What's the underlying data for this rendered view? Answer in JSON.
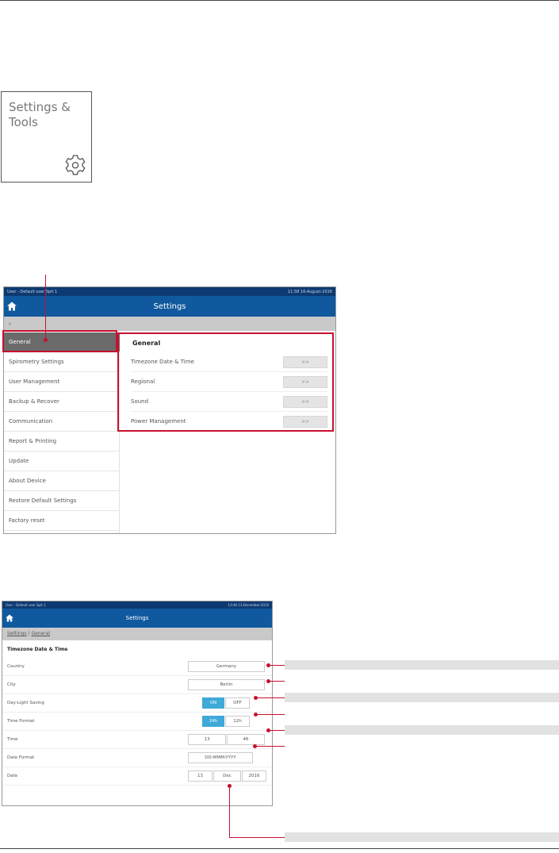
{
  "tile": {
    "title": "Settings &\nTools",
    "icon": "gear-icon"
  },
  "screen1": {
    "status_left": "User - Default user Spit 1",
    "status_right": "11:58 16-August-2016",
    "title": "Settings",
    "crumb": ">",
    "sidebar": [
      "General",
      "Spirometry Settings",
      "User Management",
      "Backup & Recover",
      "Communication",
      "Report & Printing",
      "Update",
      "About Device",
      "Restore Default Settings",
      "Factory reset"
    ],
    "panel_title": "General",
    "panel_rows": [
      {
        "label": "Timezone Date & Time",
        "button": ">>"
      },
      {
        "label": "Regional",
        "button": ">>"
      },
      {
        "label": "Sound",
        "button": ">>"
      },
      {
        "label": "Power Management",
        "button": ">>"
      }
    ]
  },
  "screen2": {
    "status_left": "User - Default user Spit 1",
    "status_right": "13:46 13-December-2016",
    "title": "Settings",
    "crumb_a": "Settings",
    "crumb_sep": " | ",
    "crumb_b": "General",
    "heading": "Timezone Date & Time",
    "rows": {
      "country": {
        "label": "Country",
        "value": "Germany"
      },
      "city": {
        "label": "City",
        "value": "Berlin"
      },
      "dst": {
        "label": "Day-Light Saving",
        "on": "ON",
        "off": "OFF"
      },
      "time_format": {
        "label": "Time Format",
        "a": "24h",
        "b": "12h"
      },
      "time": {
        "label": "Time",
        "hour": "13",
        "minute": "46"
      },
      "date_format": {
        "label": "Date Format",
        "value": "DD-MMM-YYYY"
      },
      "date": {
        "label": "Date",
        "day": "13",
        "month": "Dec",
        "year": "2016"
      }
    }
  },
  "colors": {
    "accent_red": "#c8102e",
    "titlebar_blue": "#10599e",
    "toggle_blue": "#3fa9d8"
  }
}
